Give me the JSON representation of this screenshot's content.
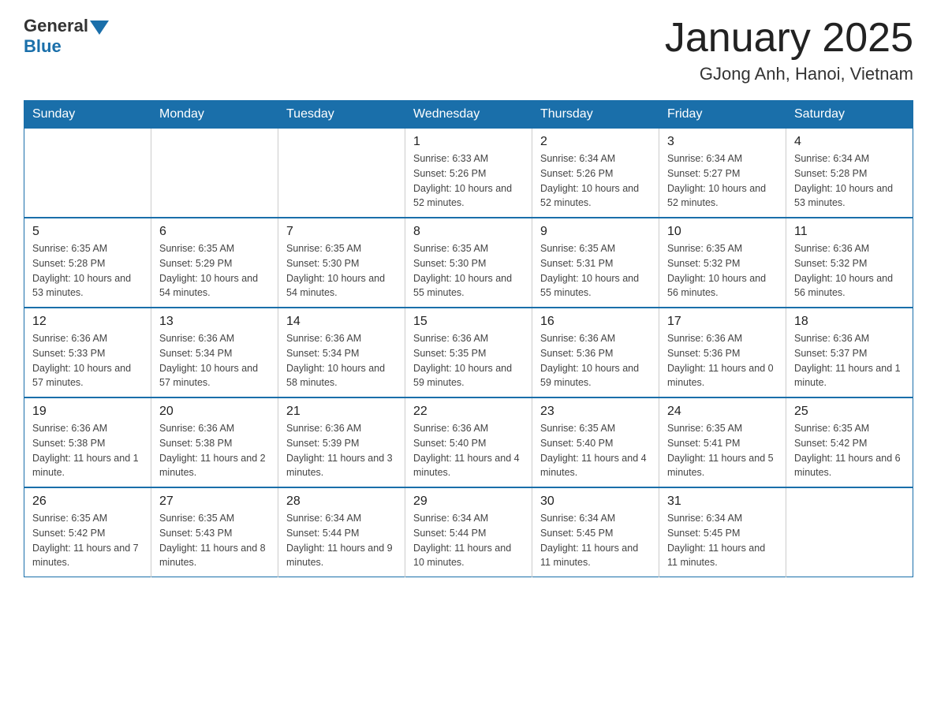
{
  "header": {
    "logo_general": "General",
    "logo_blue": "Blue",
    "month_title": "January 2025",
    "location": "GJong Anh, Hanoi, Vietnam"
  },
  "weekdays": [
    "Sunday",
    "Monday",
    "Tuesday",
    "Wednesday",
    "Thursday",
    "Friday",
    "Saturday"
  ],
  "weeks": [
    [
      {
        "day": "",
        "info": ""
      },
      {
        "day": "",
        "info": ""
      },
      {
        "day": "",
        "info": ""
      },
      {
        "day": "1",
        "info": "Sunrise: 6:33 AM\nSunset: 5:26 PM\nDaylight: 10 hours and 52 minutes."
      },
      {
        "day": "2",
        "info": "Sunrise: 6:34 AM\nSunset: 5:26 PM\nDaylight: 10 hours and 52 minutes."
      },
      {
        "day": "3",
        "info": "Sunrise: 6:34 AM\nSunset: 5:27 PM\nDaylight: 10 hours and 52 minutes."
      },
      {
        "day": "4",
        "info": "Sunrise: 6:34 AM\nSunset: 5:28 PM\nDaylight: 10 hours and 53 minutes."
      }
    ],
    [
      {
        "day": "5",
        "info": "Sunrise: 6:35 AM\nSunset: 5:28 PM\nDaylight: 10 hours and 53 minutes."
      },
      {
        "day": "6",
        "info": "Sunrise: 6:35 AM\nSunset: 5:29 PM\nDaylight: 10 hours and 54 minutes."
      },
      {
        "day": "7",
        "info": "Sunrise: 6:35 AM\nSunset: 5:30 PM\nDaylight: 10 hours and 54 minutes."
      },
      {
        "day": "8",
        "info": "Sunrise: 6:35 AM\nSunset: 5:30 PM\nDaylight: 10 hours and 55 minutes."
      },
      {
        "day": "9",
        "info": "Sunrise: 6:35 AM\nSunset: 5:31 PM\nDaylight: 10 hours and 55 minutes."
      },
      {
        "day": "10",
        "info": "Sunrise: 6:35 AM\nSunset: 5:32 PM\nDaylight: 10 hours and 56 minutes."
      },
      {
        "day": "11",
        "info": "Sunrise: 6:36 AM\nSunset: 5:32 PM\nDaylight: 10 hours and 56 minutes."
      }
    ],
    [
      {
        "day": "12",
        "info": "Sunrise: 6:36 AM\nSunset: 5:33 PM\nDaylight: 10 hours and 57 minutes."
      },
      {
        "day": "13",
        "info": "Sunrise: 6:36 AM\nSunset: 5:34 PM\nDaylight: 10 hours and 57 minutes."
      },
      {
        "day": "14",
        "info": "Sunrise: 6:36 AM\nSunset: 5:34 PM\nDaylight: 10 hours and 58 minutes."
      },
      {
        "day": "15",
        "info": "Sunrise: 6:36 AM\nSunset: 5:35 PM\nDaylight: 10 hours and 59 minutes."
      },
      {
        "day": "16",
        "info": "Sunrise: 6:36 AM\nSunset: 5:36 PM\nDaylight: 10 hours and 59 minutes."
      },
      {
        "day": "17",
        "info": "Sunrise: 6:36 AM\nSunset: 5:36 PM\nDaylight: 11 hours and 0 minutes."
      },
      {
        "day": "18",
        "info": "Sunrise: 6:36 AM\nSunset: 5:37 PM\nDaylight: 11 hours and 1 minute."
      }
    ],
    [
      {
        "day": "19",
        "info": "Sunrise: 6:36 AM\nSunset: 5:38 PM\nDaylight: 11 hours and 1 minute."
      },
      {
        "day": "20",
        "info": "Sunrise: 6:36 AM\nSunset: 5:38 PM\nDaylight: 11 hours and 2 minutes."
      },
      {
        "day": "21",
        "info": "Sunrise: 6:36 AM\nSunset: 5:39 PM\nDaylight: 11 hours and 3 minutes."
      },
      {
        "day": "22",
        "info": "Sunrise: 6:36 AM\nSunset: 5:40 PM\nDaylight: 11 hours and 4 minutes."
      },
      {
        "day": "23",
        "info": "Sunrise: 6:35 AM\nSunset: 5:40 PM\nDaylight: 11 hours and 4 minutes."
      },
      {
        "day": "24",
        "info": "Sunrise: 6:35 AM\nSunset: 5:41 PM\nDaylight: 11 hours and 5 minutes."
      },
      {
        "day": "25",
        "info": "Sunrise: 6:35 AM\nSunset: 5:42 PM\nDaylight: 11 hours and 6 minutes."
      }
    ],
    [
      {
        "day": "26",
        "info": "Sunrise: 6:35 AM\nSunset: 5:42 PM\nDaylight: 11 hours and 7 minutes."
      },
      {
        "day": "27",
        "info": "Sunrise: 6:35 AM\nSunset: 5:43 PM\nDaylight: 11 hours and 8 minutes."
      },
      {
        "day": "28",
        "info": "Sunrise: 6:34 AM\nSunset: 5:44 PM\nDaylight: 11 hours and 9 minutes."
      },
      {
        "day": "29",
        "info": "Sunrise: 6:34 AM\nSunset: 5:44 PM\nDaylight: 11 hours and 10 minutes."
      },
      {
        "day": "30",
        "info": "Sunrise: 6:34 AM\nSunset: 5:45 PM\nDaylight: 11 hours and 11 minutes."
      },
      {
        "day": "31",
        "info": "Sunrise: 6:34 AM\nSunset: 5:45 PM\nDaylight: 11 hours and 11 minutes."
      },
      {
        "day": "",
        "info": ""
      }
    ]
  ]
}
